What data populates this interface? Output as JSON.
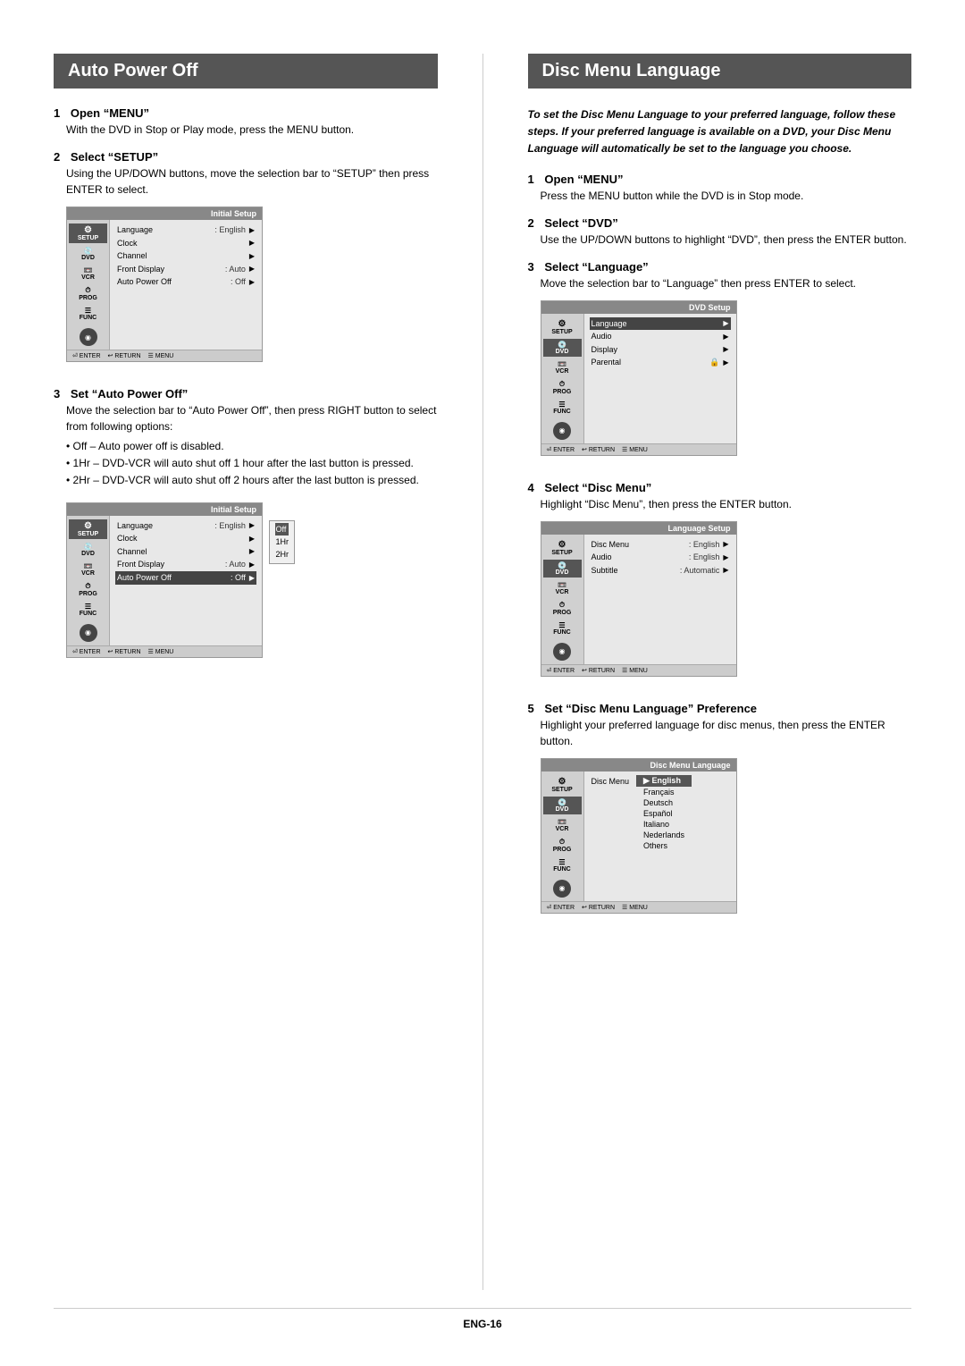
{
  "page": {
    "footer_label": "ENG-16"
  },
  "left_section": {
    "title": "Auto Power Off",
    "steps": [
      {
        "number": "1",
        "title": "Open “MENU”",
        "body": "With the DVD in Stop or Play mode, press the MENU button."
      },
      {
        "number": "2",
        "title": "Select “SETUP”",
        "body": "Using the UP/DOWN buttons, move the selection bar to “SETUP”  then press ENTER to select."
      },
      {
        "number": "3",
        "title": "Set “Auto Power Off”",
        "body": "Move the selection bar to “Auto Power Off”, then press RIGHT button to select from following options:",
        "bullets": [
          "Off – Auto power off is disabled.",
          "1Hr – DVD-VCR will auto shut off 1 hour after the last button is pressed.",
          "2Hr – DVD-VCR will auto shut off 2 hours after the last button is  pressed."
        ]
      }
    ],
    "osd1": {
      "title": "Initial Setup",
      "menu_rows": [
        {
          "label": "Language",
          "value": ": English",
          "arrow": true,
          "highlight": false
        },
        {
          "label": "Clock",
          "value": "",
          "arrow": true,
          "highlight": false
        },
        {
          "label": "Channel",
          "value": "",
          "arrow": true,
          "highlight": false
        },
        {
          "label": "Front Display",
          "value": ": Auto",
          "arrow": true,
          "highlight": false
        },
        {
          "label": "Auto Power Off",
          "value": ": Off",
          "arrow": true,
          "highlight": false
        }
      ],
      "sidebar_items": [
        "SETUP",
        "DVD",
        "VCR",
        "PROG",
        "FUNC"
      ]
    },
    "osd2": {
      "title": "Initial Setup",
      "menu_rows": [
        {
          "label": "Language",
          "value": ": English",
          "arrow": true,
          "highlight": false
        },
        {
          "label": "Clock",
          "value": "",
          "arrow": true,
          "highlight": false
        },
        {
          "label": "Channel",
          "value": "",
          "arrow": true,
          "highlight": false
        },
        {
          "label": "Front Display",
          "value": ": Auto",
          "arrow": true,
          "highlight": false
        },
        {
          "label": "Auto Power Off",
          "value": ": Off",
          "arrow": true,
          "highlight": true
        }
      ],
      "sidebar_items": [
        "SETUP",
        "DVD",
        "VCR",
        "PROG",
        "FUNC"
      ],
      "popup_items": [
        "Off",
        "1Hr",
        "2Hr"
      ],
      "popup_selected": "Off"
    }
  },
  "right_section": {
    "title": "Disc Menu Language",
    "intro": "To set the Disc Menu Language to your preferred language, follow these steps. If your preferred language is available on a DVD, your Disc Menu Language will automatically be set to the language you choose.",
    "steps": [
      {
        "number": "1",
        "title": "Open “MENU”",
        "body": "Press the MENU button while the DVD is in Stop mode."
      },
      {
        "number": "2",
        "title": "Select “DVD”",
        "body": "Use the UP/DOWN buttons to highlight “DVD”, then press the ENTER button."
      },
      {
        "number": "3",
        "title": "Select “Language”",
        "body": "Move the selection bar to “Language” then press ENTER to select."
      },
      {
        "number": "4",
        "title": "Select “Disc Menu”",
        "body": "Highlight “Disc Menu”, then press the ENTER button."
      },
      {
        "number": "5",
        "title": "Set “Disc Menu Language” Preference",
        "body": "Highlight your preferred language for disc menus, then press the ENTER button."
      }
    ],
    "osd_dvd": {
      "title": "DVD Setup",
      "menu_rows": [
        {
          "label": "Language",
          "value": "",
          "arrow": true,
          "highlight": true
        },
        {
          "label": "Audio",
          "value": "",
          "arrow": true,
          "highlight": false
        },
        {
          "label": "Display",
          "value": "",
          "arrow": true,
          "highlight": false
        },
        {
          "label": "Parental",
          "value": "🔒",
          "arrow": true,
          "highlight": false
        }
      ],
      "sidebar_items": [
        "SETUP",
        "DVD",
        "VCR",
        "PROG",
        "FUNC"
      ]
    },
    "osd_lang": {
      "title": "Language Setup",
      "menu_rows": [
        {
          "label": "Disc Menu",
          "value": ": English",
          "arrow": true,
          "highlight": false
        },
        {
          "label": "Audio",
          "value": ": English",
          "arrow": true,
          "highlight": false
        },
        {
          "label": "Subtitle",
          "value": ": Automatic",
          "arrow": true,
          "highlight": false
        }
      ],
      "sidebar_items": [
        "SETUP",
        "DVD",
        "VCR",
        "PROG",
        "FUNC"
      ]
    },
    "osd_disc_lang": {
      "title": "Disc Menu Language",
      "menu_rows": [
        {
          "label": "Disc Menu",
          "value": "",
          "arrow": false,
          "highlight": false
        }
      ],
      "popup_items": [
        "English",
        "Français",
        "Deutsch",
        "Español",
        "Italiano",
        "Nederlands",
        "Others"
      ],
      "popup_selected": "English",
      "sidebar_items": [
        "SETUP",
        "DVD",
        "VCR",
        "PROG",
        "FUNC"
      ]
    }
  }
}
